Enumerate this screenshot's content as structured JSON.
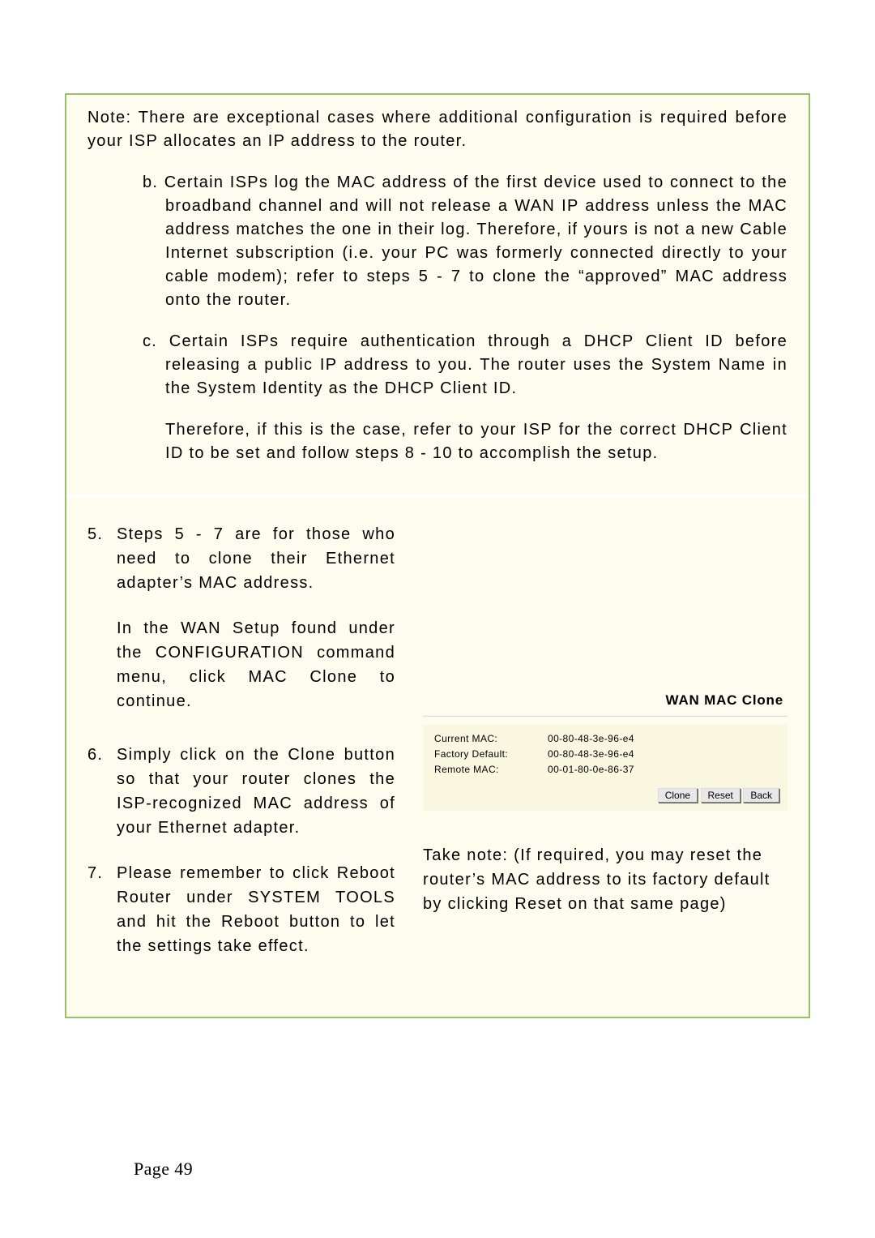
{
  "note_intro": "Note: There are exceptional cases where additional configuration is required before your ISP allocates an IP address to the router.",
  "sub_b_marker": "b.",
  "sub_b": "Certain ISPs log the MAC address of the first device used to connect to the broadband channel and will not release a WAN IP address unless the MAC address matches the one in their log. Therefore, if yours is not a new Cable Internet subscription (i.e. your PC was formerly connected directly to your cable modem); refer to steps 5 - 7 to clone the “approved” MAC address onto the router.",
  "sub_c_marker": "c.",
  "sub_c": "Certain ISPs require authentication through a DHCP Client ID before releasing a public IP address to you. The router uses the System Name in the System Identity as the DHCP Client ID.",
  "sub_c_para2": "Therefore, if this is the case, refer to your ISP for the correct DHCP Client ID to be set and follow steps 8 - 10 to accomplish the setup.",
  "step5_num": "5.",
  "step5_p1": "Steps 5 - 7 are for those who need to clone their Ethernet adapter’s MAC address.",
  "step5_p2": "In the WAN Setup found under the CONFIGURATION command menu, click MAC Clone to continue.",
  "step6_num": "6.",
  "step6": "Simply click on the Clone button so that your router clones the ISP-recognized MAC address of your Ethernet adapter.",
  "step7_num": "7.",
  "step7": "Please remember to click Reboot Router under SYSTEM TOOLS and hit the Reboot button to let the settings take effect.",
  "mac_panel": {
    "title": "WAN MAC Clone",
    "rows": [
      {
        "label": "Current MAC:",
        "value": "00-80-48-3e-96-e4"
      },
      {
        "label": "Factory Default:",
        "value": "00-80-48-3e-96-e4"
      },
      {
        "label": "Remote MAC:",
        "value": "00-01-80-0e-86-37"
      }
    ],
    "buttons": {
      "clone": "Clone",
      "reset": "Reset",
      "back": "Back"
    }
  },
  "right_note": "Take note: (If required, you may reset the router’s MAC address to its factory default by clicking Reset on that same page)",
  "page_number": "Page 49"
}
